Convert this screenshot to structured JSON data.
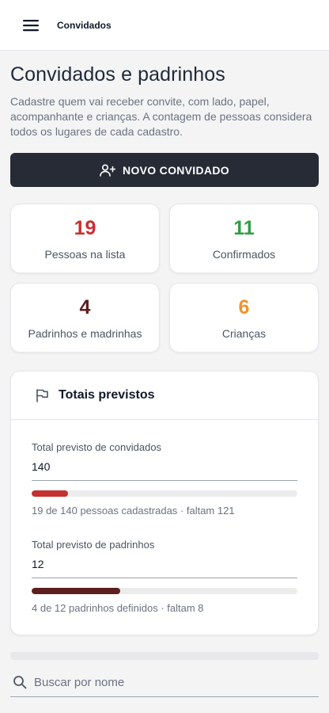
{
  "appbar": {
    "title": "Convidados"
  },
  "page": {
    "title": "Convidados e padrinhos",
    "description": "Cadastre quem vai receber convite, com lado, papel, acompanhante e crianças. A contagem de pessoas considera todos os lugares de cada cadastro."
  },
  "new_guest_button": {
    "label": "NOVO CONVIDADO"
  },
  "stats": [
    {
      "value": "19",
      "label": "Pessoas na lista",
      "color": "#c53030"
    },
    {
      "value": "11",
      "label": "Confirmados",
      "color": "#2f9e44"
    },
    {
      "value": "4",
      "label": "Padrinhos e madrinhas",
      "color": "#5c1e1e"
    },
    {
      "value": "6",
      "label": "Crianças",
      "color": "#f0932b"
    }
  ],
  "totals": {
    "title": "Totais previstos",
    "guests": {
      "label": "Total previsto de convidados",
      "value": "140",
      "progress": 0.136,
      "progress_color": "#c53030",
      "summary": "19 de 140 pessoas cadastradas · faltam 121"
    },
    "godparents": {
      "label": "Total previsto de padrinhos",
      "value": "12",
      "progress": 0.333,
      "progress_color": "#5c1e1e",
      "summary": "4 de 12 padrinhos definidos · faltam 8"
    }
  },
  "search": {
    "placeholder": "Buscar por nome"
  },
  "icons": {
    "menu": "menu-icon",
    "add_user": "user-plus-icon",
    "flag": "flag-icon",
    "search": "search-icon"
  }
}
